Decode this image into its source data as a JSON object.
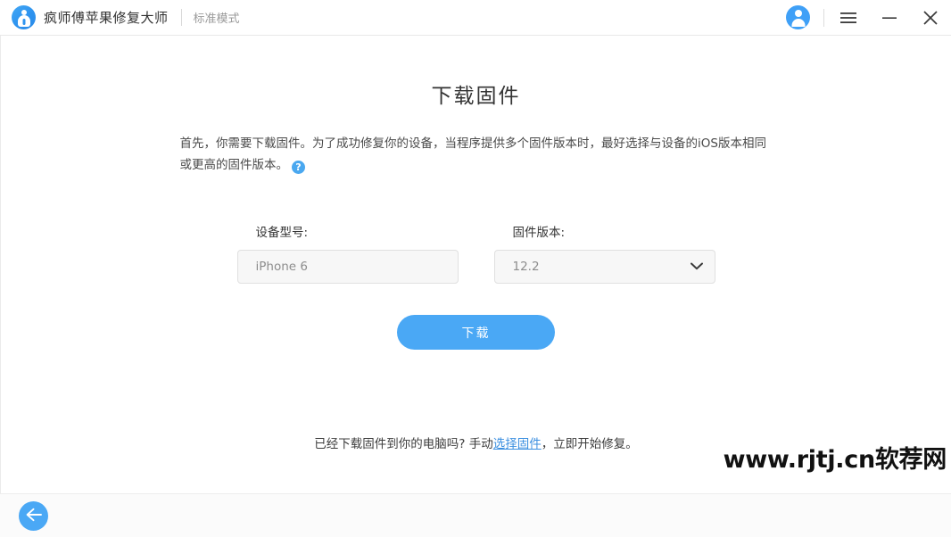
{
  "titlebar": {
    "app_name": "疯师傅苹果修复大师",
    "mode": "标准模式",
    "logo_icon": "app-logo-icon",
    "avatar_icon": "user-avatar-icon",
    "menu_icon": "hamburger-menu-icon",
    "minimize_icon": "minimize-icon",
    "close_icon": "close-icon",
    "accent_color": "#4aa8f5"
  },
  "main": {
    "title": "下载固件",
    "description": "首先，你需要下载固件。为了成功修复你的设备，当程序提供多个固件版本时，最好选择与设备的iOS版本相同或更高的固件版本。",
    "help_icon_glyph": "?",
    "device_field": {
      "label": "设备型号:",
      "value": "iPhone 6"
    },
    "firmware_field": {
      "label": "固件版本:",
      "value": "12.2",
      "dropdown_icon": "chevron-down-icon"
    },
    "download_button": "下载",
    "note_prefix": "已经下载固件到你的电脑吗? 手动",
    "note_link": "选择固件",
    "note_suffix": "，立即开始修复。",
    "link_color": "#3b8fe0"
  },
  "watermark": {
    "text": "www.rjtj.cn软荐网"
  },
  "footer": {
    "back_icon": "back-arrow-icon"
  }
}
